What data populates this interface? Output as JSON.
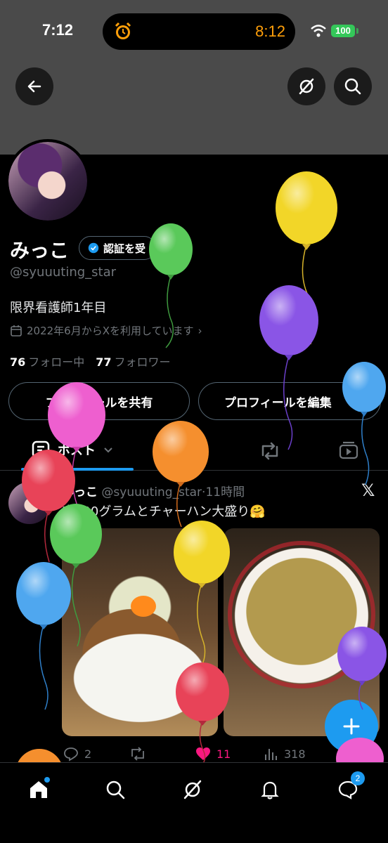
{
  "status_bar": {
    "time": "7:12",
    "island_time": "8:12",
    "battery": "100",
    "icons": [
      "alarm-icon",
      "wifi-icon",
      "battery-icon"
    ]
  },
  "header": {
    "icons": [
      "back-arrow-icon",
      "grok-icon",
      "search-icon"
    ]
  },
  "profile": {
    "name": "みっこ",
    "verify_label": "認証を受",
    "handle": "@syuuuting_star",
    "bio": "限界看護師1年目",
    "joined": "2022年6月からXを利用しています",
    "following_count": "76",
    "following_label": "フォロー中",
    "followers_count": "77",
    "followers_label": "フォロワー",
    "share_button": "プロフィールを共有",
    "edit_button": "プロフィールを編集"
  },
  "tabs": {
    "posts_label": "ポスト",
    "icons": [
      "repost-tab-icon",
      "video-tab-icon"
    ]
  },
  "post": {
    "author": "みっこ",
    "handle": "@syuuuting_star",
    "separator": "·",
    "time": "11時間",
    "text": "肉600グラムとチャーハン大盛り🤗",
    "replies": "2",
    "reposts": "",
    "likes": "11",
    "views": "318",
    "like_color": "#f91880"
  },
  "bottom_nav": {
    "items": [
      "home-icon",
      "search-icon",
      "grok-icon",
      "notifications-icon",
      "messages-icon"
    ],
    "messages_badge": "2"
  },
  "colors": {
    "accent": "#1d9bf0",
    "background": "#000000",
    "banner": "#4a4a4a"
  }
}
